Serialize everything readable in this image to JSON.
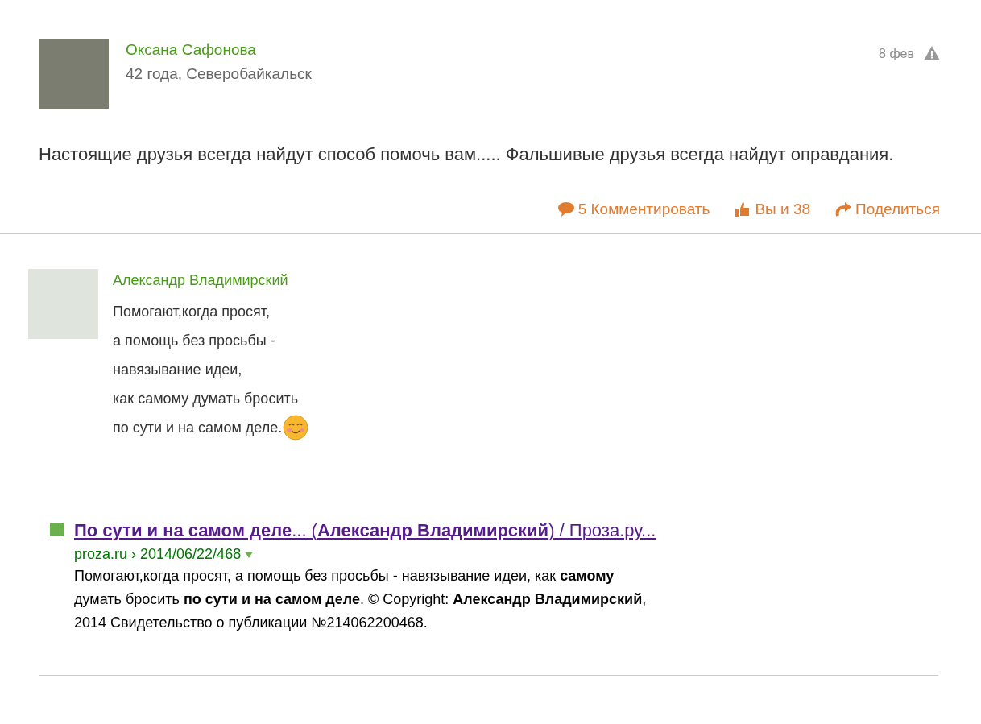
{
  "post": {
    "author": "Оксана Сафонова",
    "meta": "42 года, Северобайкальск",
    "date": "8 фев",
    "text": "Настоящие друзья всегда найдут способ помочь вам..... Фальшивые друзья всегда найдут оправдания.",
    "actions": [
      {
        "kind": "comment",
        "label": "5 Комментировать"
      },
      {
        "kind": "like",
        "label": "Вы и 38"
      },
      {
        "kind": "share",
        "label": "Поделиться"
      }
    ]
  },
  "comment": {
    "author": "Александр Владимирский",
    "lines": [
      "Помогают,когда просят,",
      "а помощь без просьбы -",
      "навязывание идеи,",
      "как самому думать бросить",
      "по сути и на самом деле."
    ]
  },
  "search_result": {
    "title": "**По сути и на самом деле**... (**Александр Владимирский**) / Проза.ру...",
    "url": "proza.ru › 2014/06/22/468",
    "snippet": "Помогают,когда просят, а помощь без просьбы - навязывание идеи, как **самому** думать бросить **по сути и на самом деле**. © Copyright: **Александр Владимирский**, 2014 Свидетельство о публикации №214062200468."
  }
}
